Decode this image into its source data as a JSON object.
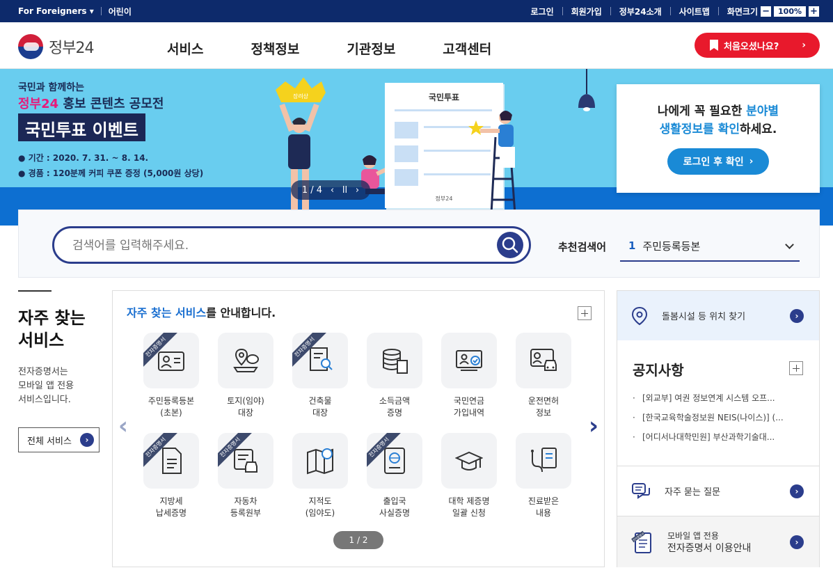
{
  "topbar": {
    "foreigners": "For Foreigners",
    "kids": "어린이",
    "links": [
      "로그인",
      "회원가입",
      "정부24소개",
      "사이트맵"
    ],
    "zoom_label": "화면크기",
    "zoom_minus": "−",
    "zoom_value": "100%",
    "zoom_plus": "+"
  },
  "header": {
    "logo_text": "정부24",
    "nav": [
      "서비스",
      "정책정보",
      "기관정보",
      "고객센터"
    ],
    "first_visit": "처음오셨나요?"
  },
  "banner": {
    "sub": "국민과 함께하는",
    "title_pink": "정부24",
    "title_rest": " 홍보 콘텐츠 공모전",
    "event": "국민투표 이벤트",
    "period": "● 기간 : 2020. 7. 31. ~ 8. 14.",
    "prize": "● 경품 : 120분께 커피 쿠폰 증정 (5,000원 상당)",
    "paper_title": "국민투표",
    "paper_footer": "정부24",
    "crown_text": "장려상",
    "slide_pos": "1 / 4",
    "slide_prev": "‹",
    "slide_pause": "ll",
    "slide_next": "›"
  },
  "login_card": {
    "line1_a": "나에게 꼭 필요한 ",
    "line1_b": "분야별",
    "line2_a": "생활정보를 확인",
    "line2_b": "하세요.",
    "button": "로그인 후 확인"
  },
  "search": {
    "placeholder": "검색어를 입력해주세요.",
    "rec_label": "추천검색어",
    "rec_num": "1",
    "rec_value": "주민등록등본"
  },
  "freq": {
    "heading_1": "자주 찾는",
    "heading_2": "서비스",
    "desc_1": "전자증명서는",
    "desc_2": "모바일 앱 전용",
    "desc_3": "서비스입니다.",
    "all_button": "전체 서비스"
  },
  "services": {
    "title_hl": "자주 찾는 서비스",
    "title_rest": "를 안내합니다.",
    "ribbon": "전자증명서",
    "items": [
      {
        "label": "주민등록등본\n(초본)",
        "icon": "id-card-icon",
        "ribbon": true
      },
      {
        "label": "토지(임야)\n대장",
        "icon": "map-pin-chat-icon",
        "ribbon": false
      },
      {
        "label": "건축물\n대장",
        "icon": "document-search-icon",
        "ribbon": true
      },
      {
        "label": "소득금액\n증명",
        "icon": "database-doc-icon",
        "ribbon": false
      },
      {
        "label": "국민연금\n가입내역",
        "icon": "monitor-check-icon",
        "ribbon": false
      },
      {
        "label": "운전면허\n정보",
        "icon": "license-car-icon",
        "ribbon": false
      },
      {
        "label": "지방세\n납세증명",
        "icon": "document-icon",
        "ribbon": true
      },
      {
        "label": "자동차\n등록원부",
        "icon": "scroll-car-icon",
        "ribbon": true
      },
      {
        "label": "지적도\n(임야도)",
        "icon": "map-search-icon",
        "ribbon": false
      },
      {
        "label": "출입국\n사실증명",
        "icon": "passport-icon",
        "ribbon": true
      },
      {
        "label": "대학 제증명\n일괄 신청",
        "icon": "graduation-cap-icon",
        "ribbon": false
      },
      {
        "label": "진료받은\n내용",
        "icon": "stethoscope-icon",
        "ribbon": false
      }
    ],
    "pager": "1 / 2",
    "prev": "‹",
    "next": "›"
  },
  "right": {
    "location": "돌봄시설 등 위치 찾기",
    "notice_title": "공지사항",
    "notices": [
      "[외교부] 여권 정보연계 시스템 오프...",
      "[한국교육학술정보원 NEIS(나이스)] (...",
      "[어디서나대학민원] 부산과학기술대..."
    ],
    "faq": "자주 묻는 질문",
    "mobile_1": "모바일 앱 전용",
    "mobile_2": "전자증명서 이용안내",
    "mobile_ribbon": "전자증명서"
  }
}
